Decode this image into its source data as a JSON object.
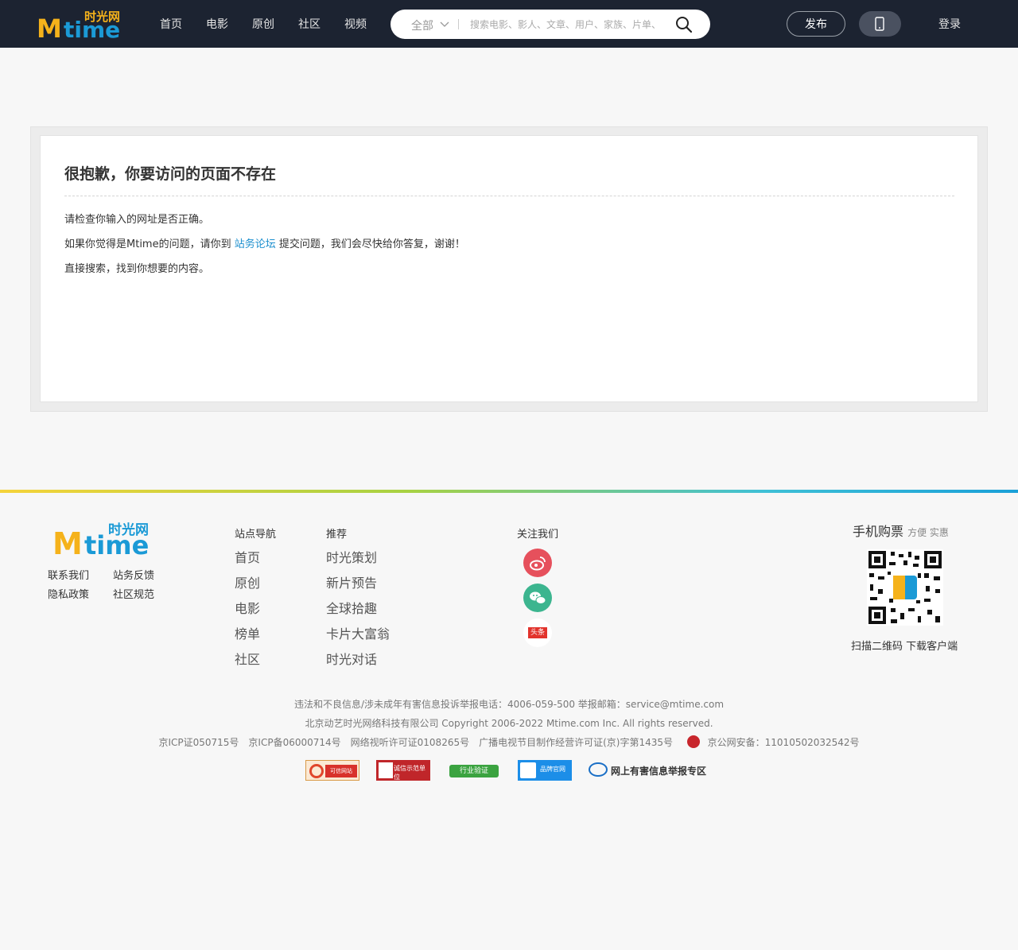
{
  "header": {
    "logo_sub": "时光网",
    "logo_main": "Mtime",
    "nav": [
      "首页",
      "电影",
      "原创",
      "社区",
      "视频"
    ],
    "search": {
      "category": "全部",
      "placeholder": "搜索电影、影人、文章、用户、家族、片单、"
    },
    "publish": "发布",
    "login": "登录"
  },
  "error": {
    "title": "很抱歉，你要访问的页面不存在",
    "line1": "请检查你输入的网址是否正确。",
    "line2_prefix": "如果你觉得是Mtime的问题，请你到",
    "line2_link": "站务论坛",
    "line2_suffix": "提交问题，我们会尽快给你答复，谢谢！",
    "line3": "直接搜索，找到你想要的内容。"
  },
  "footer": {
    "logo_sub": "时光网",
    "logo_main": "Mtime",
    "links": [
      "联系我们",
      "站务反馈",
      "隐私政策",
      "社区规范"
    ],
    "nav_head": "站点导航",
    "nav_items": [
      "首页",
      "原创",
      "电影",
      "榜单",
      "社区"
    ],
    "rec_head": "推荐",
    "rec_items": [
      "时光策划",
      "新片预告",
      "全球拾趣",
      "卡片大富翁",
      "时光对话"
    ],
    "follow_head": "关注我们",
    "toutiao": "头条",
    "qr_title": "手机购票",
    "qr_sub": "方便 实惠",
    "qr_caption": "扫描二维码 下载客户端",
    "legal1": "违法和不良信息/涉未成年有害信息投诉举报电话：4006-059-500 举报邮箱：service@mtime.com",
    "legal2": "北京动艺时光网络科技有限公司 Copyright 2006-2022 Mtime.com Inc. All rights reserved.",
    "legal3": "京ICP证050715号　京ICP备06000714号　网络视听许可证0108265号　广播电视节目制作经营许可证(京)字第1435号",
    "police": "京公网安备：11010502032542号",
    "badges": {
      "b1": "可信网站",
      "b2": "诚信示范单位",
      "b3": "行业验证",
      "b4": "品牌官网",
      "b5": "网上有害信息举报专区"
    }
  },
  "colors": {
    "header_bg": "#1c2331",
    "link": "#1c8fce",
    "logo_yellow": "#f5b21b",
    "logo_blue": "#1b9ad6",
    "weibo": "#e6505c",
    "wechat": "#3cb58f"
  }
}
